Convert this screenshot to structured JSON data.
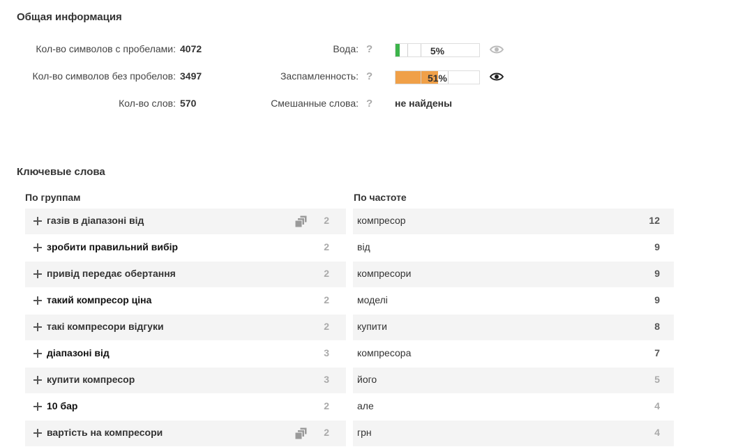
{
  "general": {
    "title": "Общая информация",
    "chars_with_spaces": {
      "label": "Кол-во символов с пробелами:",
      "value": "4072"
    },
    "chars_without_spaces": {
      "label": "Кол-во символов без пробелов:",
      "value": "3497"
    },
    "words": {
      "label": "Кол-во слов:",
      "value": "570"
    },
    "water": {
      "label": "Вода:",
      "help": "?",
      "value_text": "5%",
      "percent": 5,
      "color": "#3cb44b"
    },
    "spam": {
      "label": "Заспамленность:",
      "help": "?",
      "value_text": "51%",
      "percent": 51,
      "color": "#f0a048"
    },
    "mixed": {
      "label": "Смешанные слова:",
      "help": "?",
      "value": "не найдены"
    }
  },
  "keywords": {
    "title": "Ключевые слова",
    "groups_title": "По группам",
    "freq_title": "По частоте",
    "groups": [
      {
        "text": "газів в діапазоні від",
        "count": "2",
        "copy_icon": true
      },
      {
        "text": "зробити правильний вибір",
        "count": "2",
        "copy_icon": false
      },
      {
        "text": "привід передає обертання",
        "count": "2",
        "copy_icon": false
      },
      {
        "text": "такий компресор ціна",
        "count": "2",
        "copy_icon": false
      },
      {
        "text": "такі компресори відгуки",
        "count": "2",
        "copy_icon": false
      },
      {
        "text": "діапазоні від",
        "count": "3",
        "copy_icon": false
      },
      {
        "text": "купити компресор",
        "count": "3",
        "copy_icon": false
      },
      {
        "text": "10 бар",
        "count": "2",
        "copy_icon": false
      },
      {
        "text": "вартість на компресори",
        "count": "2",
        "copy_icon": true
      }
    ],
    "frequency": [
      {
        "word": "компресор",
        "count": "12"
      },
      {
        "word": "від",
        "count": "9"
      },
      {
        "word": "компресори",
        "count": "9"
      },
      {
        "word": "моделі",
        "count": "9"
      },
      {
        "word": "купити",
        "count": "8"
      },
      {
        "word": "компресора",
        "count": "7"
      },
      {
        "word": "його",
        "count": "5"
      },
      {
        "word": "але",
        "count": "4"
      },
      {
        "word": "грн",
        "count": "4"
      }
    ]
  },
  "colors": {
    "text": "#333333",
    "muted": "#aaaaaa",
    "row_alt": "#f4f4f4",
    "water_bar": "#3cb44b",
    "spam_bar": "#f0a048"
  }
}
